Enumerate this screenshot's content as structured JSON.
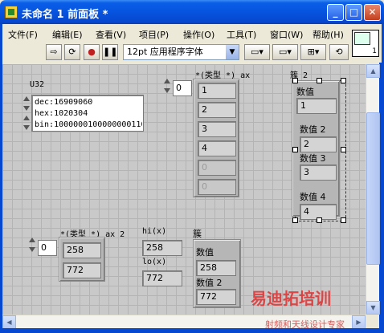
{
  "window": {
    "title": "未命名 1 前面板 *",
    "buttons": {
      "minimize": "_",
      "maximize": "□",
      "close": "✕"
    }
  },
  "menu": [
    "文件(F)",
    "编辑(E)",
    "查看(V)",
    "项目(P)",
    "操作(O)",
    "工具(T)",
    "窗口(W)",
    "帮助(H)"
  ],
  "toolbar": {
    "font": "12pt 应用程序字体",
    "run_icon": "run-arrow-icon",
    "vi_number": "1"
  },
  "u32": {
    "label": "U32",
    "dec": "dec:16909060",
    "hex": "hex:1020304",
    "bin": "bin:1000000100000000110"
  },
  "array1": {
    "label": "*(类型 *) ax",
    "index": "0",
    "values": [
      "1",
      "2",
      "3",
      "4",
      "0",
      "0"
    ]
  },
  "cluster2": {
    "label": "簇 2",
    "fields": [
      {
        "label": "数值",
        "value": "1"
      },
      {
        "label": "数值 2",
        "value": "2"
      },
      {
        "label": "数值 3",
        "value": "3"
      },
      {
        "label": "数值 4",
        "value": "4"
      }
    ]
  },
  "array2": {
    "label": "*(类型 *) ax 2",
    "index": "0",
    "values": [
      "258",
      "772"
    ]
  },
  "hilo": {
    "hi_label": "hi(x)",
    "hi_value": "258",
    "lo_label": "lo(x)",
    "lo_value": "772"
  },
  "cluster": {
    "label": "簇",
    "fields": [
      {
        "label": "数值",
        "value": "258"
      },
      {
        "label": "数值 2",
        "value": "772"
      }
    ]
  },
  "watermark": {
    "line1": "易迪拓培训",
    "line2": "射频和天线设计专家"
  }
}
